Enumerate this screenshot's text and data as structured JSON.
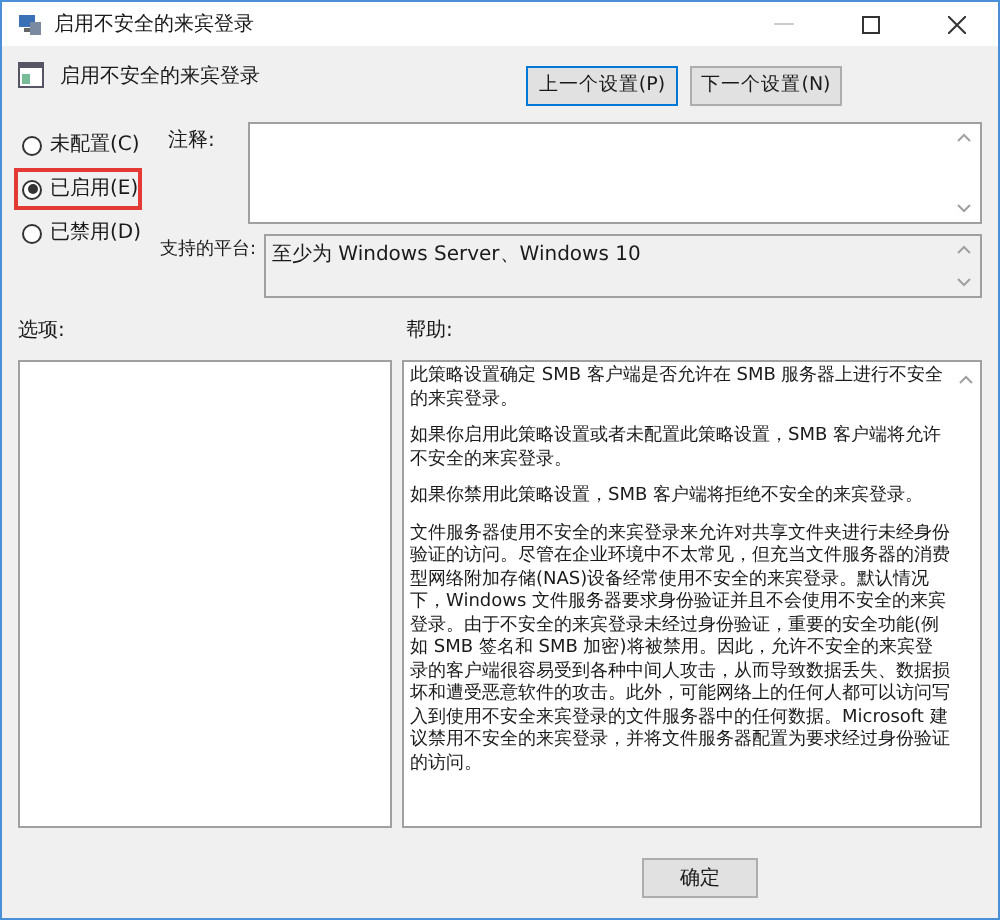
{
  "window": {
    "title": "启用不安全的来宾登录"
  },
  "header": {
    "title": "启用不安全的来宾登录",
    "buttons": [
      {
        "label": "上一个设置(P)",
        "selected": true
      },
      {
        "label": "下一个设置(N)",
        "selected": false
      }
    ]
  },
  "options": [
    {
      "label": "未配置(C)",
      "selected": false,
      "highlighted": false
    },
    {
      "label": "已启用(E)",
      "selected": true,
      "highlighted": true
    },
    {
      "label": "已禁用(D)",
      "selected": false,
      "highlighted": false
    }
  ],
  "comment": {
    "label": "注释:"
  },
  "platform": {
    "label": "支持的平台:",
    "value": "至少为 Windows Server、Windows 10"
  },
  "options_panel": {
    "label": "选项:"
  },
  "help": {
    "label": "帮助:",
    "paragraphs": [
      "此策略设置确定 SMB 客户端是否允许在 SMB 服务器上进行不安全的来宾登录。",
      "如果你启用此策略设置或者未配置此策略设置，SMB 客户端将允许不安全的来宾登录。",
      "如果你禁用此策略设置，SMB 客户端将拒绝不安全的来宾登录。",
      "文件服务器使用不安全的来宾登录来允许对共享文件夹进行未经身份验证的访问。尽管在企业环境中不太常见，但充当文件服务器的消费型网络附加存储(NAS)设备经常使用不安全的来宾登录。默认情况下，Windows 文件服务器要求身份验证并且不会使用不安全的来宾登录。由于不安全的来宾登录未经过身份验证，重要的安全功能(例如 SMB 签名和 SMB 加密)将被禁用。因此，允许不安全的来宾登录的客户端很容易受到各种中间人攻击，从而导致数据丢失、数据损坏和遭受恶意软件的攻击。此外，可能网络上的任何人都可以访问写入到使用不安全来宾登录的文件服务器中的任何数据。Microsoft 建议禁用不安全的来宾登录，并将文件服务器配置为要求经过身份验证的访问。"
    ]
  },
  "footer": {
    "buttons": [
      "确定"
    ]
  }
}
